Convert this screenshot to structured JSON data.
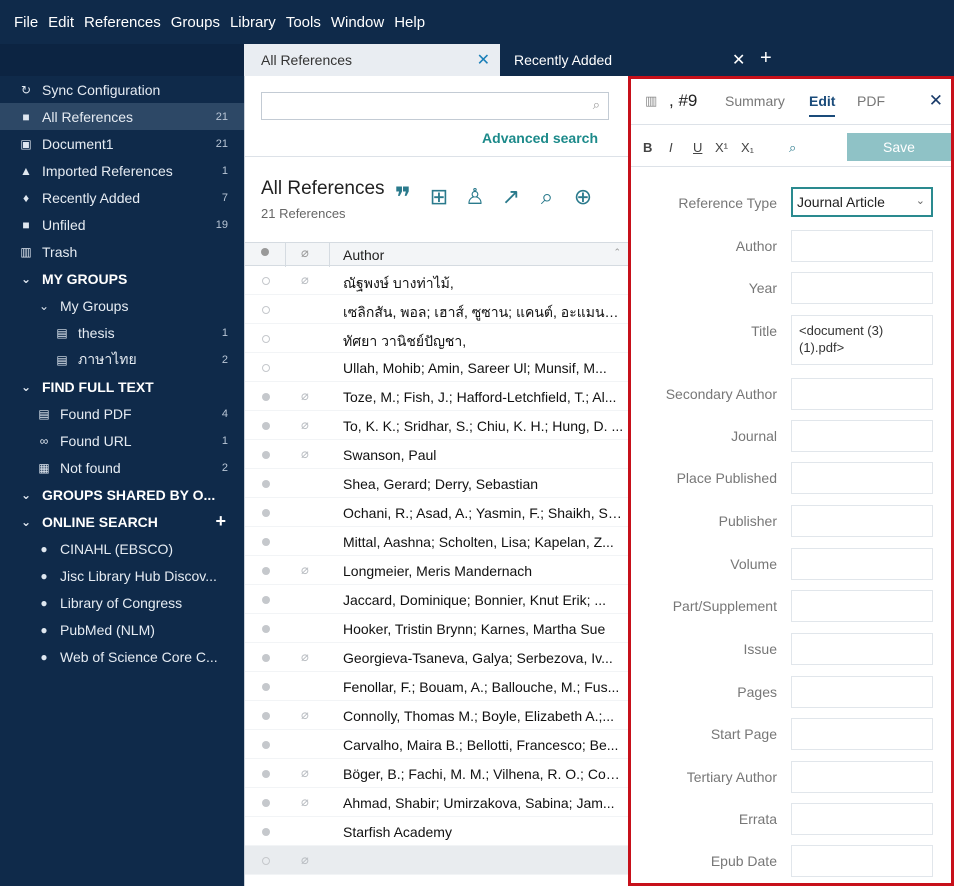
{
  "menubar": [
    "File",
    "Edit",
    "References",
    "Groups",
    "Library",
    "Tools",
    "Window",
    "Help"
  ],
  "sidebar": {
    "items": [
      {
        "label": "Sync Configuration",
        "count": "",
        "icon": "sync-icon",
        "glyph": "↻",
        "head": false,
        "indent": 0
      },
      {
        "label": "All References",
        "count": "21",
        "icon": "book-icon",
        "glyph": "■",
        "head": false,
        "indent": 0,
        "active": true
      },
      {
        "label": "Document1",
        "count": "21",
        "icon": "document-icon",
        "glyph": "▣",
        "head": false,
        "indent": 0
      },
      {
        "label": "Imported References",
        "count": "1",
        "icon": "import-icon",
        "glyph": "▲",
        "head": false,
        "indent": 0
      },
      {
        "label": "Recently Added",
        "count": "7",
        "icon": "bell-icon",
        "glyph": "♦",
        "head": false,
        "indent": 0
      },
      {
        "label": "Unfiled",
        "count": "19",
        "icon": "book-icon",
        "glyph": "■",
        "head": false,
        "indent": 0
      },
      {
        "label": "Trash",
        "count": "",
        "icon": "trash-icon",
        "glyph": "▥",
        "head": false,
        "indent": 0
      },
      {
        "label": "MY GROUPS",
        "count": "",
        "icon": "chevron-down-icon",
        "glyph": "⌄",
        "head": true,
        "indent": 0
      },
      {
        "label": "My Groups",
        "count": "",
        "icon": "chevron-down-icon",
        "glyph": "⌄",
        "head": false,
        "indent": 1
      },
      {
        "label": "thesis",
        "count": "1",
        "icon": "group-icon",
        "glyph": "▤",
        "head": false,
        "indent": 2
      },
      {
        "label": "ภาษาไทย",
        "count": "2",
        "icon": "group-icon",
        "glyph": "▤",
        "head": false,
        "indent": 2
      },
      {
        "label": "FIND FULL TEXT",
        "count": "",
        "icon": "chevron-down-icon",
        "glyph": "⌄",
        "head": true,
        "indent": 0
      },
      {
        "label": "Found PDF",
        "count": "4",
        "icon": "pdf-icon",
        "glyph": "▤",
        "head": false,
        "indent": 1
      },
      {
        "label": "Found URL",
        "count": "1",
        "icon": "link-icon",
        "glyph": "∞",
        "head": false,
        "indent": 1
      },
      {
        "label": "Not found",
        "count": "2",
        "icon": "file-icon",
        "glyph": "▦",
        "head": false,
        "indent": 1
      },
      {
        "label": "GROUPS SHARED BY O...",
        "count": "",
        "icon": "chevron-down-icon",
        "glyph": "⌄",
        "head": true,
        "indent": 0
      },
      {
        "label": "ONLINE SEARCH",
        "count": "",
        "icon": "chevron-down-icon",
        "glyph": "⌄",
        "head": true,
        "indent": 0,
        "plus": "+"
      },
      {
        "label": "CINAHL (EBSCO)",
        "count": "",
        "icon": "globe-icon",
        "glyph": "●",
        "head": false,
        "indent": 1
      },
      {
        "label": "Jisc Library Hub Discov...",
        "count": "",
        "icon": "globe-icon",
        "glyph": "●",
        "head": false,
        "indent": 1
      },
      {
        "label": "Library of Congress",
        "count": "",
        "icon": "globe-icon",
        "glyph": "●",
        "head": false,
        "indent": 1
      },
      {
        "label": "PubMed (NLM)",
        "count": "",
        "icon": "globe-icon",
        "glyph": "●",
        "head": false,
        "indent": 1
      },
      {
        "label": "Web of Science Core C...",
        "count": "",
        "icon": "globe-icon",
        "glyph": "●",
        "head": false,
        "indent": 1
      }
    ]
  },
  "tabs": {
    "tab1": "All References",
    "tab1_close": "✕",
    "tab2": "Recently Added",
    "tab2_close": "✕",
    "add": "+"
  },
  "middle": {
    "search_value": "",
    "advanced": "Advanced search",
    "title": "All References",
    "count": "21 References",
    "column_author": "Author",
    "rows": [
      {
        "author": "ณัฐพงษ์ บางท่าไม้,",
        "clip": true,
        "dot": "ring"
      },
      {
        "author": "เซลิกสัน, พอล; เฮาส์, ซูซาน; แคนต์, อะแมนดา; ...",
        "clip": false,
        "dot": "ring"
      },
      {
        "author": "ทัศยา วานิชย์ปัญชา,",
        "clip": false,
        "dot": "ring"
      },
      {
        "author": "Ullah, Mohib; Amin, Sareer Ul; Munsif, M...",
        "clip": false,
        "dot": "ring"
      },
      {
        "author": "Toze, M.; Fish, J.; Hafford-Letchfield, T.; Al...",
        "clip": true,
        "dot": "solid"
      },
      {
        "author": "To, K. K.; Sridhar, S.; Chiu, K. H.; Hung, D. ...",
        "clip": true,
        "dot": "solid"
      },
      {
        "author": "Swanson, Paul",
        "clip": true,
        "dot": "solid"
      },
      {
        "author": "Shea, Gerard; Derry, Sebastian",
        "clip": false,
        "dot": "solid"
      },
      {
        "author": "Ochani, R.; Asad, A.; Yasmin, F.; Shaikh, S.; ...",
        "clip": false,
        "dot": "solid"
      },
      {
        "author": "Mittal, Aashna; Scholten, Lisa; Kapelan, Z...",
        "clip": false,
        "dot": "solid"
      },
      {
        "author": "Longmeier, Meris Mandernach",
        "clip": true,
        "dot": "solid"
      },
      {
        "author": "Jaccard, Dominique; Bonnier, Knut Erik; ...",
        "clip": false,
        "dot": "solid"
      },
      {
        "author": "Hooker, Tristin Brynn; Karnes, Martha Sue",
        "clip": false,
        "dot": "solid"
      },
      {
        "author": "Georgieva-Tsaneva, Galya; Serbezova, Iv...",
        "clip": true,
        "dot": "solid"
      },
      {
        "author": "Fenollar, F.; Bouam, A.; Ballouche, M.; Fus...",
        "clip": false,
        "dot": "solid"
      },
      {
        "author": "Connolly, Thomas M.; Boyle, Elizabeth A.;...",
        "clip": true,
        "dot": "solid"
      },
      {
        "author": "Carvalho, Maira B.; Bellotti, Francesco; Be...",
        "clip": false,
        "dot": "solid"
      },
      {
        "author": "Böger, B.; Fachi, M. M.; Vilhena, R. O.; Cob...",
        "clip": true,
        "dot": "solid"
      },
      {
        "author": "Ahmad, Shabir; Umirzakova, Sabina; Jam...",
        "clip": true,
        "dot": "solid"
      },
      {
        "author": "Starfish Academy",
        "clip": false,
        "dot": "solid"
      },
      {
        "author": "",
        "clip": true,
        "dot": "ring",
        "gray": true
      }
    ]
  },
  "right": {
    "ref_num": ", #9",
    "summary": "Summary",
    "edit": "Edit",
    "pdf": "PDF",
    "close": "✕",
    "format": [
      "B",
      "I",
      "U",
      "X¹",
      "X₁"
    ],
    "save": "Save",
    "reference_type_label": "Reference Type",
    "reference_type_value": "Journal Article",
    "title_value": "<document (3)(1).pdf>",
    "fields": [
      "Author",
      "Year",
      "Title",
      "Secondary Author",
      "Journal",
      "Place Published",
      "Publisher",
      "Volume",
      "Part/Supplement",
      "Issue",
      "Pages",
      "Start Page",
      "Tertiary Author",
      "Errata",
      "Epub Date"
    ]
  },
  "colors": {
    "sidebar_bg": "#0f2a4a",
    "accent": "#1c8a8a",
    "highlight_border": "#c7101a"
  }
}
